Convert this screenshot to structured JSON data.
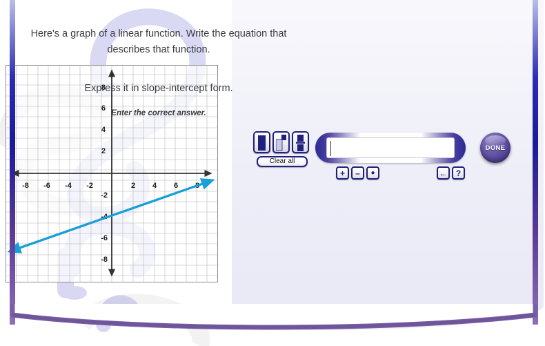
{
  "question": {
    "prompt": "Here's a graph of a linear function. Write the equation that describes that function.",
    "instruction": "Express it in slope-intercept form.",
    "hint": "Enter the correct answer."
  },
  "toolbar": {
    "templates": [
      {
        "name": "box-template",
        "icon": "empty-box"
      },
      {
        "name": "exponent-template",
        "icon": "superscript-box"
      },
      {
        "name": "fraction-template",
        "icon": "fraction-box"
      }
    ],
    "clear_all_label": "Clear all",
    "operators": [
      {
        "name": "plus-button",
        "label": "+"
      },
      {
        "name": "minus-button",
        "label": "–"
      },
      {
        "name": "decimal-point-button",
        "label": "●"
      }
    ],
    "navigation": [
      {
        "name": "backspace-button",
        "label": "←"
      },
      {
        "name": "help-button",
        "label": "?"
      }
    ]
  },
  "answer": {
    "value": "",
    "placeholder": ""
  },
  "done_button": {
    "label": "DONE"
  },
  "colors": {
    "line": "#179fd8",
    "axis": "#3a3a3a",
    "grid": "#a9a9a9",
    "panel_border_top": "#1a1a9c",
    "panel_border_bottom": "#8d6fb6",
    "button_outline": "#20207e",
    "done_fill": "#55469a"
  },
  "chart_data": {
    "type": "line",
    "title": "",
    "xlabel": "",
    "ylabel": "",
    "xlim": [
      -10,
      10
    ],
    "ylim": [
      -10,
      10
    ],
    "grid": true,
    "x_ticks": [
      -8,
      -6,
      -4,
      -2,
      2,
      4,
      6,
      8
    ],
    "y_ticks": [
      8,
      6,
      4,
      2,
      -2,
      -4,
      -6,
      -8
    ],
    "x_tick_labels": [
      "-8",
      "-6",
      "-4",
      "-2",
      "2",
      "4",
      "6",
      "8"
    ],
    "y_tick_labels": [
      "8",
      "6",
      "4",
      "2",
      "-2",
      "-4",
      "-6",
      "-8"
    ],
    "series": [
      {
        "name": "linear-function",
        "equation": "y = (1/3)x - 4",
        "slope": 0.3333,
        "intercept": -4,
        "x": [
          -10,
          10
        ],
        "y": [
          -7.333,
          -0.667
        ],
        "color": "#179fd8",
        "arrows": "both"
      }
    ]
  }
}
